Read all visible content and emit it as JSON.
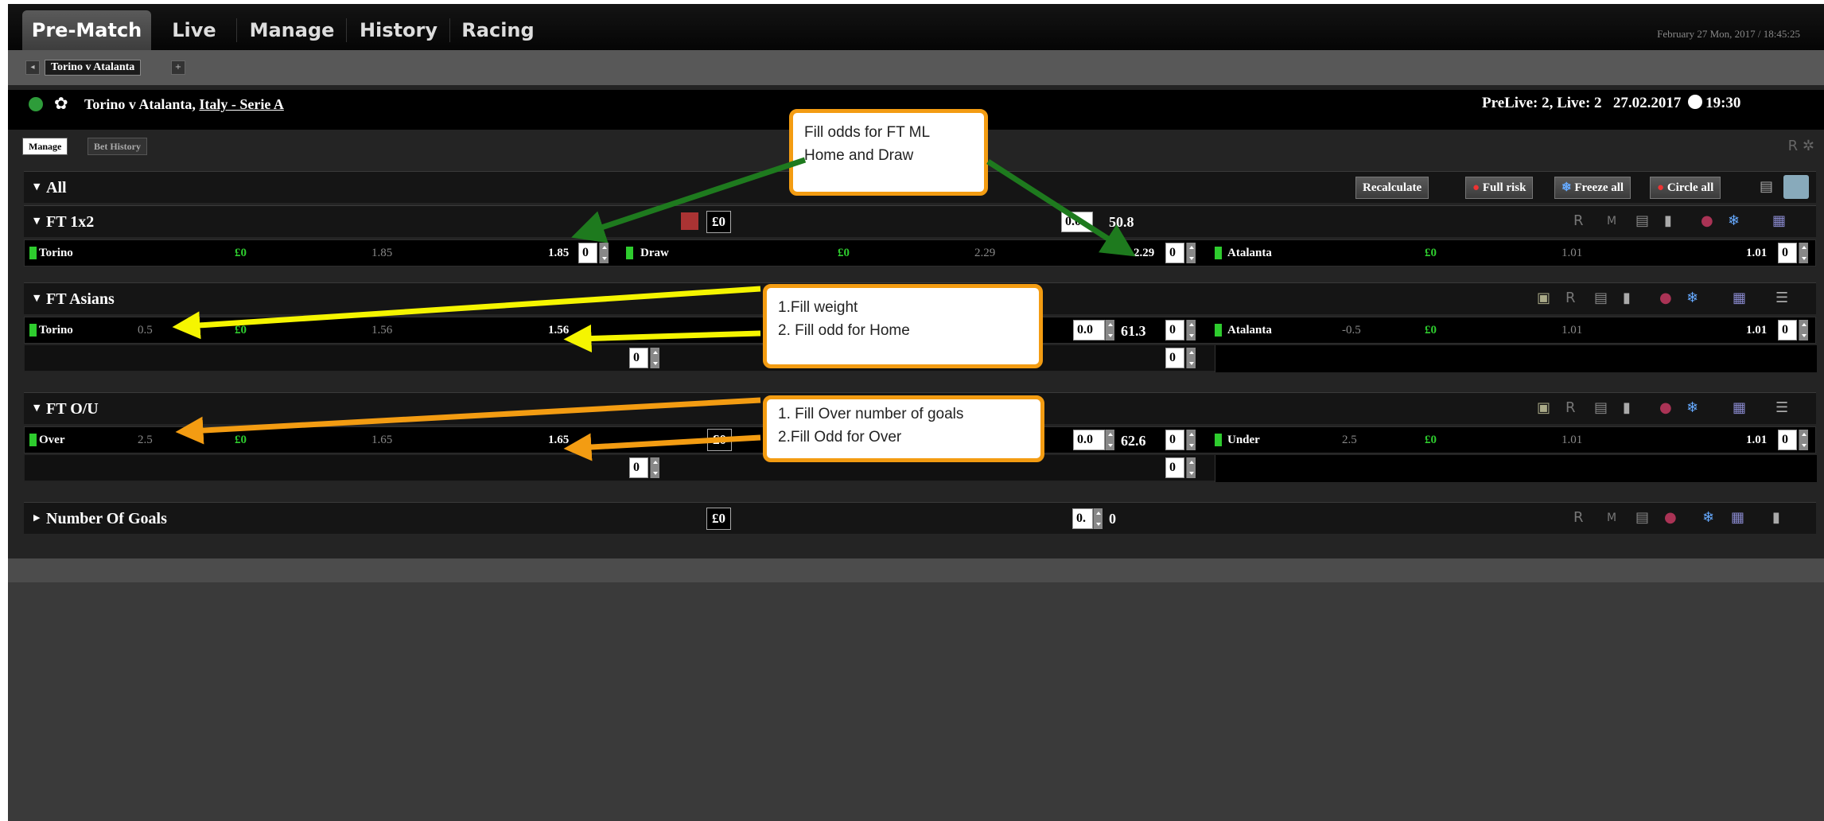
{
  "nav": {
    "tabs": [
      "Pre-Match",
      "Live",
      "Manage",
      "History",
      "Racing"
    ],
    "datetime": "February 27 Mon, 2017 / 18:45:25"
  },
  "event_tab": "Torino v Atalanta",
  "event": {
    "title": "Torino v Atalanta,",
    "league": "Italy - Serie A",
    "counts": "PreLive: 2, Live: 2",
    "date": "27.02.2017",
    "time": "19:30"
  },
  "subtabs": [
    "Manage",
    "Bet History"
  ],
  "all": {
    "label": "All",
    "buttons": [
      "Recalculate",
      "Full risk",
      "Freeze all",
      "Circle all"
    ]
  },
  "ft1x2": {
    "label": "FT 1x2",
    "stake": "£0",
    "weight": "0.0",
    "pct": "50.8",
    "home": {
      "name": "Torino",
      "stake": "£0",
      "odds": "1.85",
      "odds2": "1.85",
      "qty": "0"
    },
    "draw": {
      "name": "Draw",
      "stake": "£0",
      "odds": "2.29",
      "odds2": "2.29",
      "qty": "0"
    },
    "away": {
      "name": "Atalanta",
      "stake": "£0",
      "odds": "1.01",
      "odds2": "1.01",
      "qty": "0"
    }
  },
  "ftasians": {
    "label": "FT Asians",
    "home": {
      "name": "Torino",
      "line": "0.5",
      "stake": "£0",
      "odds": "1.56",
      "odds2": "1.56"
    },
    "weight": "0.0",
    "pct": "61.3",
    "qty": "0",
    "qty_b": "0",
    "qty_c": "0",
    "qty_d": "0",
    "away": {
      "name": "Atalanta",
      "line": "-0.5",
      "stake": "£0",
      "odds": "1.01",
      "odds2": "1.01",
      "qty": "0"
    }
  },
  "ftou": {
    "label": "FT O/U",
    "over": {
      "name": "Over",
      "line": "2.5",
      "stake": "£0",
      "odds": "1.65",
      "odds2": "1.65"
    },
    "stake": "£0",
    "weight": "0.0",
    "pct": "62.6",
    "qty": "0",
    "qty_b": "0",
    "qty_c": "0",
    "under": {
      "name": "Under",
      "line": "2.5",
      "stake": "£0",
      "odds": "1.01",
      "odds2": "1.01",
      "qty": "0"
    }
  },
  "goals": {
    "label": "Number Of Goals",
    "stake": "£0",
    "weight": "0.",
    "pct": "0"
  },
  "notes": {
    "n1": [
      "Fill odds for FT ML",
      "Home and Draw"
    ],
    "n2": [
      "1.Fill weight",
      "2. Fill odd for Home"
    ],
    "n3": [
      "1. Fill Over number of goals",
      "2.Fill Odd for Over"
    ]
  },
  "colors": {
    "green": "#2ecc2e",
    "arrow_green": "#1e7a1e",
    "arrow_yellow": "#f5f500",
    "arrow_orange": "#f39c12"
  }
}
